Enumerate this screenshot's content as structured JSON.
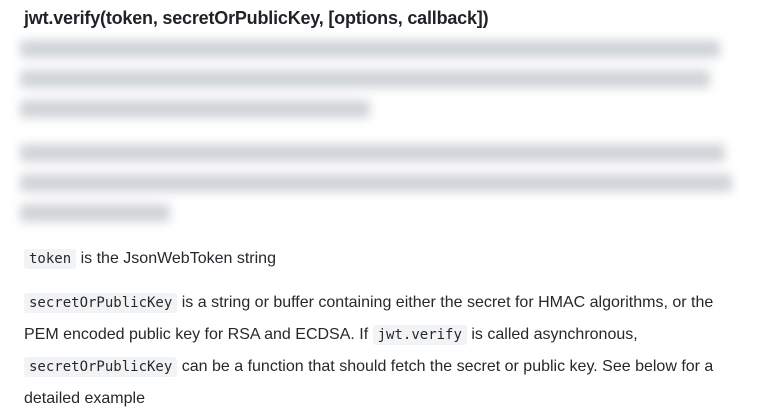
{
  "heading": "jwt.verify(token, secretOrPublicKey, [options, callback])",
  "paragraph_token": {
    "code": "token",
    "text": "is the JsonWebToken string"
  },
  "paragraph_secret": {
    "code1": "secretOrPublicKey",
    "text1": "is a string or buffer containing either the secret for HMAC algorithms, or the PEM encoded public key for RSA and ECDSA. If",
    "code2": "jwt.verify",
    "text2": "is called asynchronous,",
    "code3": "secretOrPublicKey",
    "text3": "can be a function that should fetch the secret or public key. See below for a detailed example"
  }
}
